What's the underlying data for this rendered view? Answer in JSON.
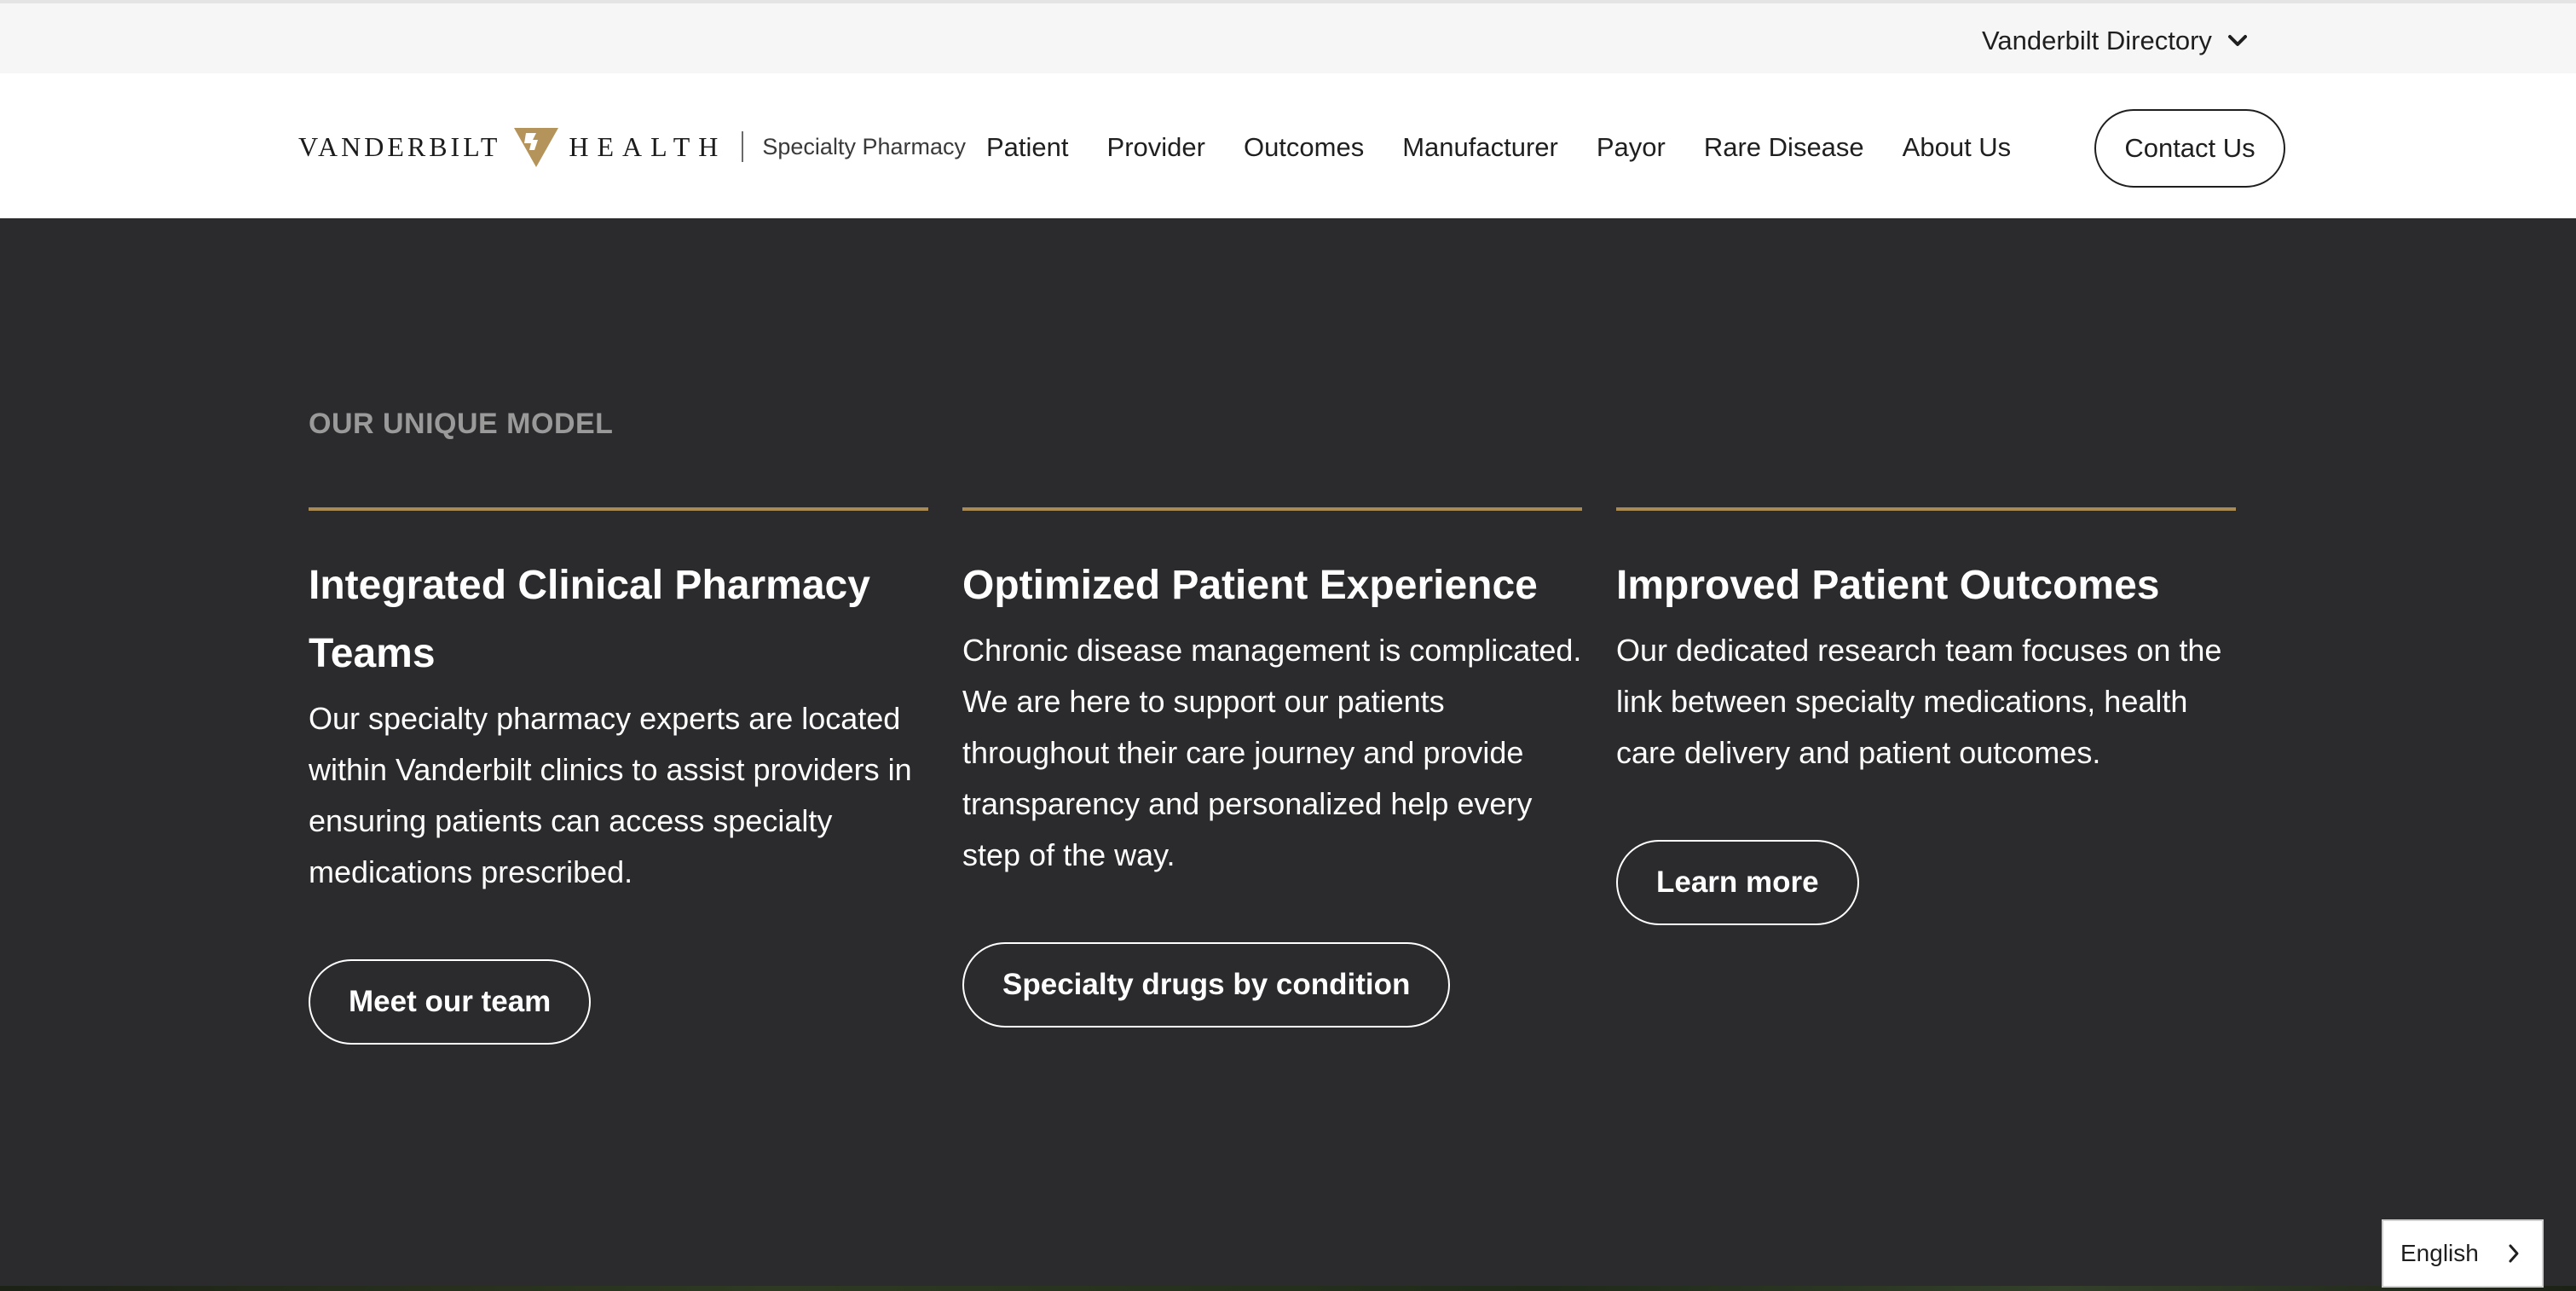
{
  "utility": {
    "directory_label": "Vanderbilt Directory"
  },
  "header": {
    "logo": {
      "word_left": "VANDERBILT",
      "word_right": "HEALTH",
      "subtitle": "Specialty Pharmacy",
      "mark_color": "#b5945b"
    },
    "nav": [
      {
        "label": "Patient"
      },
      {
        "label": "Provider"
      },
      {
        "label": "Outcomes"
      },
      {
        "label": "Manufacturer"
      },
      {
        "label": "Payor"
      },
      {
        "label": "Rare Disease"
      },
      {
        "label": "About Us"
      }
    ],
    "contact_label": "Contact Us"
  },
  "section": {
    "eyebrow": "OUR UNIQUE MODEL",
    "accent_color": "#a98a55",
    "columns": [
      {
        "title": "Integrated Clinical Pharmacy Teams",
        "text": "Our specialty pharmacy experts are located within Vanderbilt clinics to assist providers in ensuring patients can access specialty medications prescribed.",
        "button": "Meet our team"
      },
      {
        "title": "Optimized Patient Experience",
        "text": "Chronic disease management is complicated. We are here to support our patients throughout their care journey and provide transparency and personalized help every step of the way.",
        "button": "Specialty drugs by condition"
      },
      {
        "title": "Improved Patient Outcomes",
        "text": "Our dedicated research team focuses on the link between specialty medications, health care delivery and patient outcomes.",
        "button": "Learn more"
      }
    ]
  },
  "language": {
    "selected": "English"
  }
}
